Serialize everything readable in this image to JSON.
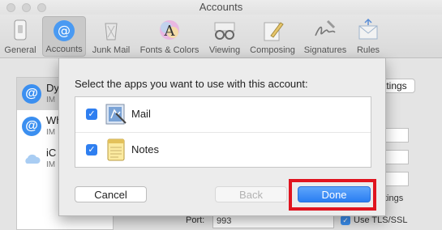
{
  "window": {
    "title": "Accounts"
  },
  "toolbar": {
    "items": [
      {
        "label": "General",
        "icon": "switch-icon"
      },
      {
        "label": "Accounts",
        "icon": "at-sign-icon",
        "selected": true
      },
      {
        "label": "Junk Mail",
        "icon": "trash-icon"
      },
      {
        "label": "Fonts & Colors",
        "icon": "color-font-icon"
      },
      {
        "label": "Viewing",
        "icon": "glasses-icon"
      },
      {
        "label": "Composing",
        "icon": "pencil-icon"
      },
      {
        "label": "Signatures",
        "icon": "signature-icon"
      },
      {
        "label": "Rules",
        "icon": "rules-envelope-icon"
      }
    ]
  },
  "accounts": [
    {
      "name": "Dy",
      "sub": "IM",
      "icon": "at-sign-icon",
      "selected": true
    },
    {
      "name": "Wh",
      "sub": "IM",
      "icon": "at-sign-icon"
    },
    {
      "name": "iC",
      "sub": "IM",
      "icon": "cloud-icon"
    }
  ],
  "background": {
    "settings_btn": "ttings",
    "tings_text": "tings",
    "port_label": "Port:",
    "port_value": "993",
    "ssl_label": "Use TLS/SSL"
  },
  "sheet": {
    "prompt": "Select the apps you want to use with this account:",
    "apps": [
      {
        "name": "Mail",
        "checked": true,
        "icon": "mail-stamp-icon"
      },
      {
        "name": "Notes",
        "checked": true,
        "icon": "notes-icon"
      }
    ],
    "buttons": {
      "cancel": "Cancel",
      "back": "Back",
      "done": "Done"
    }
  },
  "colors": {
    "accent": "#2f7ff0",
    "highlight": "#e0141f"
  }
}
